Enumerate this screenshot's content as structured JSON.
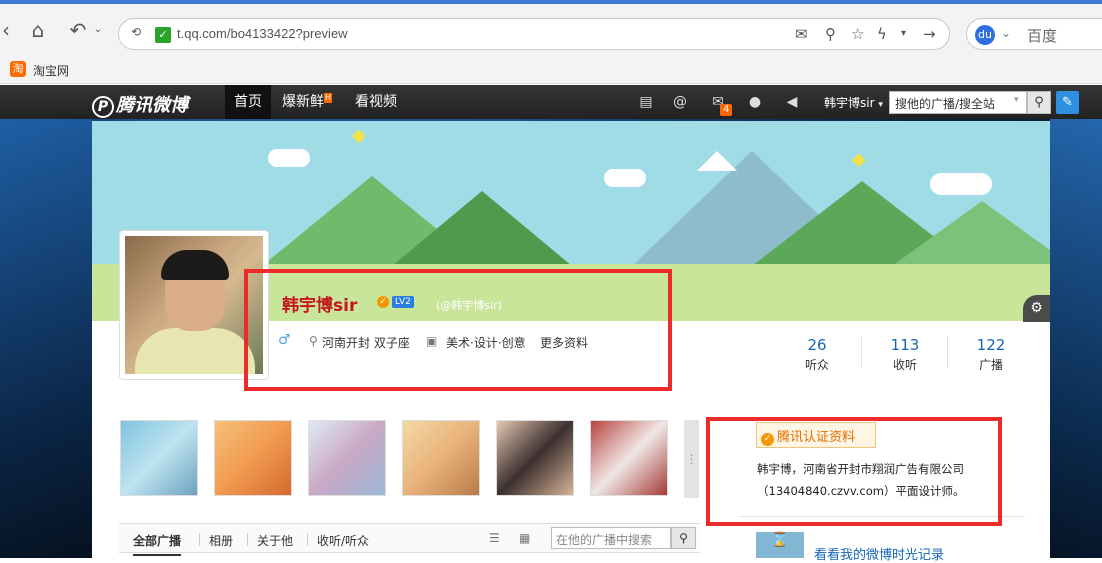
{
  "browser": {
    "url": "t.qq.com/bo4133422?preview",
    "search_engine": "百度",
    "bookmark": {
      "label": "淘宝网",
      "icon": "taobao-icon"
    }
  },
  "weibo_nav": {
    "logo": "腾讯微博",
    "tabs": [
      {
        "label": "首页",
        "active": true
      },
      {
        "label": "爆新鲜",
        "badge": "H"
      },
      {
        "label": "看视频"
      }
    ],
    "mail_count": "4",
    "user": "韩宇博sir",
    "search_placeholder": "搜他的广播/搜全站"
  },
  "profile": {
    "name": "韩宇博sir",
    "level": "LV2",
    "handle": "(@韩宇博sir)",
    "location": "河南开封 双子座",
    "industry": "美术·设计·创意",
    "more": "更多资料",
    "stats": [
      {
        "num": "26",
        "label": "听众"
      },
      {
        "num": "113",
        "label": "收听"
      },
      {
        "num": "122",
        "label": "广播"
      }
    ]
  },
  "tabs": {
    "items": [
      "全部广播",
      "相册",
      "关于他",
      "收听/听众"
    ],
    "search_placeholder": "在他的广播中搜索"
  },
  "certification": {
    "title": "腾讯认证资料",
    "line1": "韩宇博，河南省开封市翔润广告有限公司",
    "line2": "（13404840.czvv.com）平面设计师。"
  },
  "timeline_link": "看看我的微博时光记录"
}
